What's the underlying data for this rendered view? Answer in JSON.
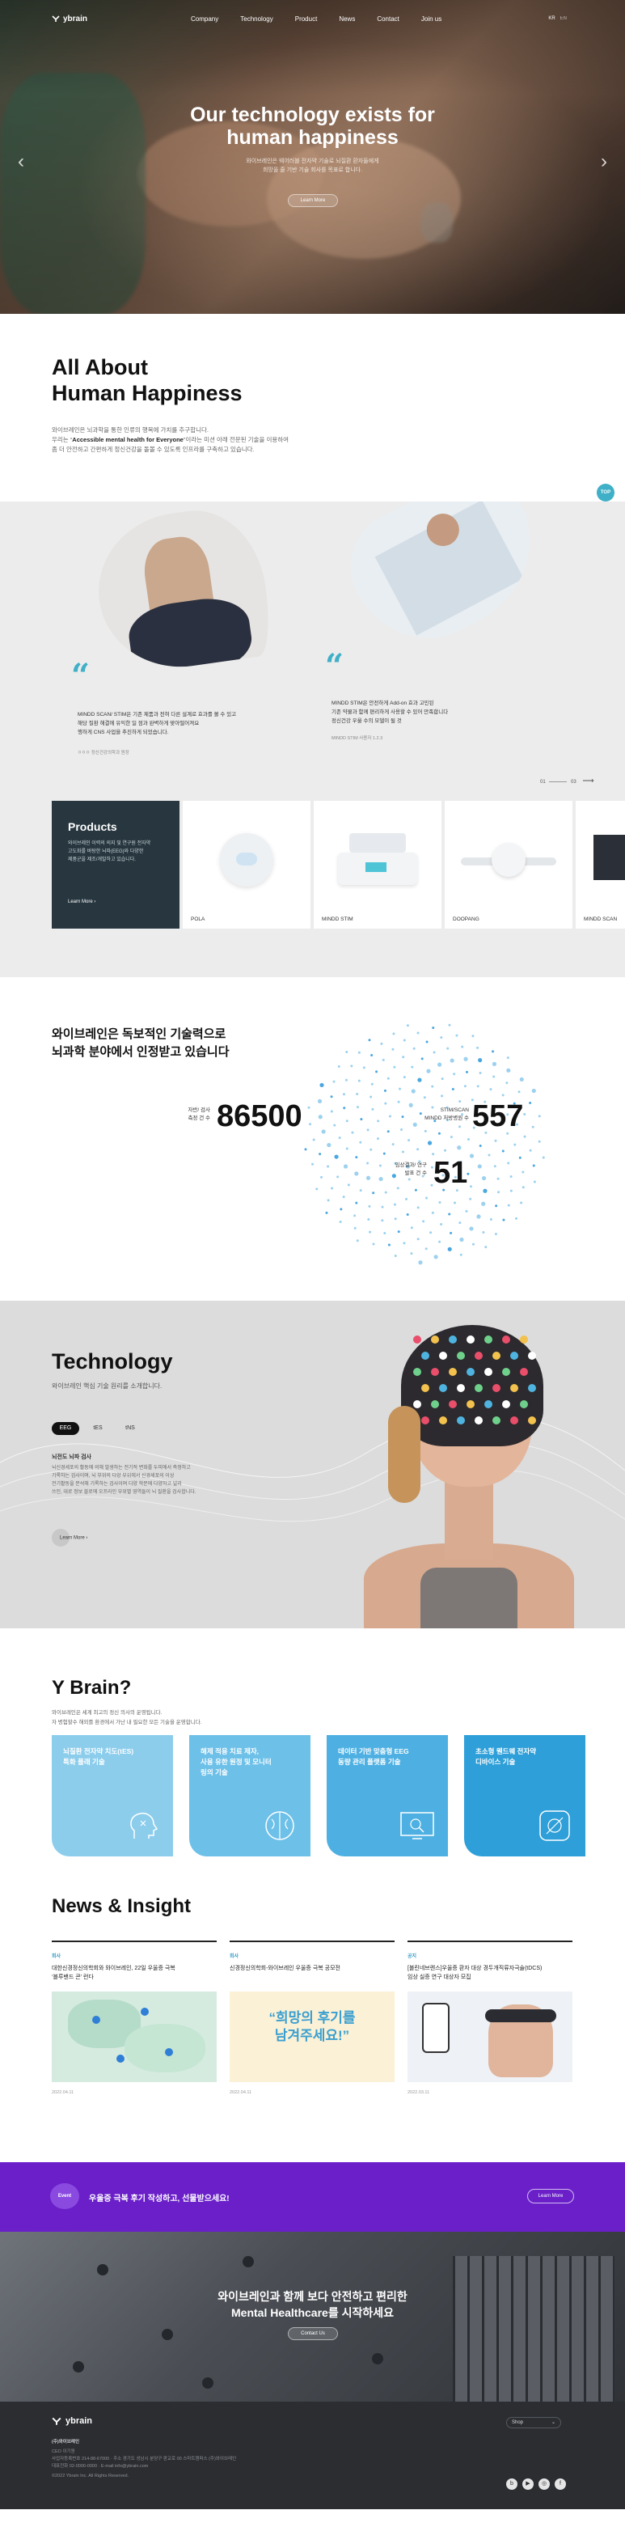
{
  "header": {
    "logo": "ybrain",
    "menu": [
      "Company",
      "Technology",
      "Product",
      "News",
      "Contact",
      "Join us"
    ],
    "lang": [
      "KR",
      "EN"
    ]
  },
  "hero": {
    "title_line1": "Our technology exists for",
    "title_line2": "human happiness",
    "subtitle_line1": "와이브레인은 웨어러블 전자약 기술로 뇌질환 환자들에게",
    "subtitle_line2": "희망을 줄 기반 기술 회사를 목표로 합니다.",
    "cta": "Learn More"
  },
  "about": {
    "title_line1": "All About",
    "title_line2": "Human Happiness",
    "para_line1": "와이브레인은 뇌과학을 통한 인류의 행복에 가치를 추구합니다.",
    "para_line2_prefix": "우리는 “",
    "para_line2_bold": "Accessible mental health for Everyone",
    "para_line2_suffix": "”이라는 미션 아래 전문된 기술을 이용하여",
    "para_line3": "좀 더 안전하고 간편하게 정신건강을 돌볼 수 있도록 인프라를 구축하고 있습니다.",
    "top_button": "TOP"
  },
  "stories": {
    "left_text_line1": "MINDD SCAN/ STIM은 기존 제품과 전혀 다른 설계로 효과를 볼 수 있고",
    "left_text_line2": "해당 질환 해결에 유익한 일 점과 완벽하게 맞아떨어져요",
    "left_text_line3": "행하게 CNS 사업을 추진하게 되었습니다.",
    "left_caption": "ㅇㅇㅇ 정신건강의학과 원장",
    "right_text_line1": "MINDD STIM은 안전하게 Add-on 효과 고민된",
    "right_text_line2": "기존 약물과 함께 편리하게 사용할 수 있어 만족합니다",
    "right_text_line3": "정신건강 우울 수의 모델이 될 것",
    "right_caption": "MINDD STIM 사용자 1.2.3",
    "pager_current": "01",
    "pager_total": "03"
  },
  "products": {
    "heading": "Products",
    "desc_line1": "와이브레인 이력의 의지 및 연구원 전자약",
    "desc_line2": "고도화를 바탕한 뇌파(EEG)와 다양한",
    "desc_line3": "제품군을 제조/개발하고 있습니다.",
    "more": "Learn More",
    "items": [
      "POLA",
      "MINDD STIM",
      "DOOPANG",
      "MINDD SCAN"
    ]
  },
  "stats": {
    "title_line1": "와이브레인은 독보적인 기술력으로",
    "title_line2": "뇌과학 분야에서 인정받고 있습니다",
    "items": [
      {
        "label_line1": "자반/ 검사",
        "label_line2": "측정 건 수",
        "value": "86500"
      },
      {
        "label_line1": "STIM/SCAN",
        "label_line2": "MINDD 처방병원 수",
        "value": "557"
      },
      {
        "label_line1": "임상결과/ 연구",
        "label_line2": "발표 건 수",
        "value": "51"
      }
    ]
  },
  "technology": {
    "title": "Technology",
    "subtitle": "와이브레인 핵심 기술 원리를 소개합니다.",
    "tabs": [
      "EEG",
      "tES",
      "tNS"
    ],
    "active_tab": "EEG",
    "heading": "뇌전도 뇌파 검사",
    "para_line1": "뇌신경세포의 활동에 의해 발생하는 전기적 변화를 두피에서 측정하고",
    "para_line2": "기록하는 검사이며, 뇌 부위의 다양 부위에서 신경세포의 이상",
    "para_line3": "전기활동을 분석해 기록하는 검사이며 다양 학문에 다양하고 널리",
    "para_line4": "쓰인, 대로 정보 블로에 오프라인 부위별 영역들이 뇌 질환을 검사합니다.",
    "more": "Learn More"
  },
  "ybrain": {
    "title": "Y Brain?",
    "para_line1": "와이브레인은 세계 최고의 정신 의사의 운영됩니다.",
    "para_line2": "자 병험할수 해외를 환경에서 가난 내 필요한 모든 기술을 운영합니다.",
    "cards": [
      {
        "line1": "뇌질환 전자약 치도(tES)",
        "line2": "특화 플래 기술"
      },
      {
        "line1": "해제 적용 치료 제자,",
        "line2": "사용 유한 원정 및 모니터",
        "line3": "링의 기술"
      },
      {
        "line1": "데이터 기반 맞춤형 EEG",
        "line2": "동량 관리 플랫폼 기술"
      },
      {
        "line1": "초소형 웬드웨 전자약",
        "line2": "디바이스 기술"
      }
    ]
  },
  "news": {
    "title": "News & Insight",
    "items": [
      {
        "category": "회사",
        "title_line1": "대한신경정신의학회와 와이브레인, 22일 우울증 극복",
        "title_line2": "‘블루밴드 콘’ 런다",
        "thumb_text": "",
        "date": "2022.04.11"
      },
      {
        "category": "회사",
        "title_line1": "신경정신의학회-와이브레인 우울증 극복 공모전",
        "title_line2": "",
        "thumb_text_line1": "“희망의 후기를",
        "thumb_text_line2": "남겨주세요!”",
        "date": "2022.04.11"
      },
      {
        "category": "공지",
        "title_line1": "[블린네브렌스]우울증 환자 대상 경두개직류자극술(tDCS)",
        "title_line2": "임상 실증 연구 대상자 모집",
        "thumb_text": "",
        "date": "2022.03.11"
      }
    ]
  },
  "event": {
    "badge": "Event",
    "message": "우울증 극복 후기 작성하고, 선물받으세요!",
    "cta": "Learn More"
  },
  "contact": {
    "title_line1": "와이브레인과 함께 보다 안전하고 편리한",
    "title_line2": "Mental Healthcare를 시작하세요",
    "cta": "Contact Us"
  },
  "footer": {
    "logo": "ybrain",
    "company": "(주)와이브레인",
    "line1": "CEO 이기원",
    "line2": "사업자등록번호 214-88-67000 · 주소 경기도 성남시 분당구 판교로 00 스마트캠퍼스 (주)와이브레인",
    "line3": "대표전화 02-0000-0000 · E-mail info@ybrain.com",
    "copyright": "©2022 Ybrain Inc. All Rights Reserved.",
    "family_site": "Shop",
    "sns": [
      "blog-icon",
      "youtube-icon",
      "instagram-icon",
      "facebook-icon"
    ]
  },
  "colors": {
    "accent": "#3fb0c7",
    "event": "#6a1fc9",
    "dark": "#27363f",
    "card": "#4fb3e0"
  }
}
